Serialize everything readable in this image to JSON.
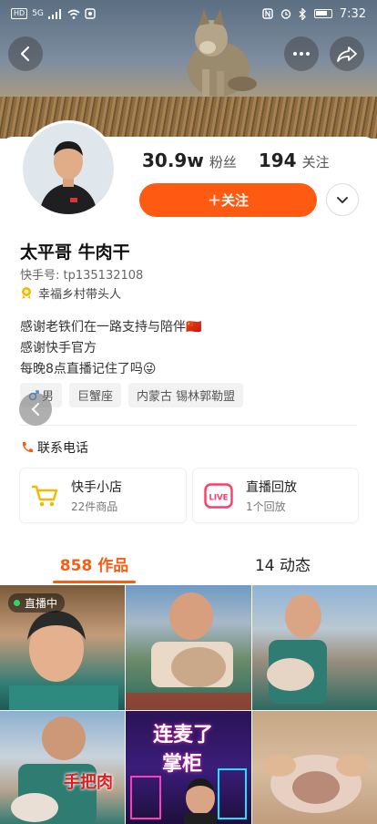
{
  "status_bar": {
    "time": "7:32",
    "left_chips": [
      "HD",
      "5G"
    ]
  },
  "banner": {
    "back_icon": "chevron-left-icon",
    "more_icon": "more-dots-icon",
    "share_icon": "share-icon"
  },
  "profile": {
    "followers_count": "30.9w",
    "followers_label": "粉丝",
    "following_count": "194",
    "following_label": "关注",
    "follow_button_label": "＋关注",
    "name": "太平哥 牛肉干",
    "kuaishou_id": "快手号: tp135132108",
    "badge_text": "幸福乡村带头人",
    "bio_lines": [
      "感谢老铁们在一路支持与陪伴🇨🇳",
      "感谢快手官方",
      "每晚8点直播记住了吗😜"
    ],
    "tags": [
      "男",
      "巨蟹座",
      "内蒙古 锡林郭勒盟"
    ],
    "contact_label": "联系电话"
  },
  "shop_cards": [
    {
      "title": "快手小店",
      "subtitle": "22件商品"
    },
    {
      "title": "直播回放",
      "subtitle": "1个回放",
      "icon_text": "LIVE"
    }
  ],
  "tabs": [
    {
      "label": "858 作品",
      "active": true
    },
    {
      "label": "14 动态",
      "active": false
    }
  ],
  "grid": {
    "live_badge": "直播中",
    "cell_texts": [
      "手把肉",
      "连麦了",
      "掌柜"
    ]
  },
  "colors": {
    "accent": "#fe5a12",
    "live_green": "#2bd66b",
    "shop_yellow": "#f5b800",
    "live_pink": "#ff3b6b"
  }
}
